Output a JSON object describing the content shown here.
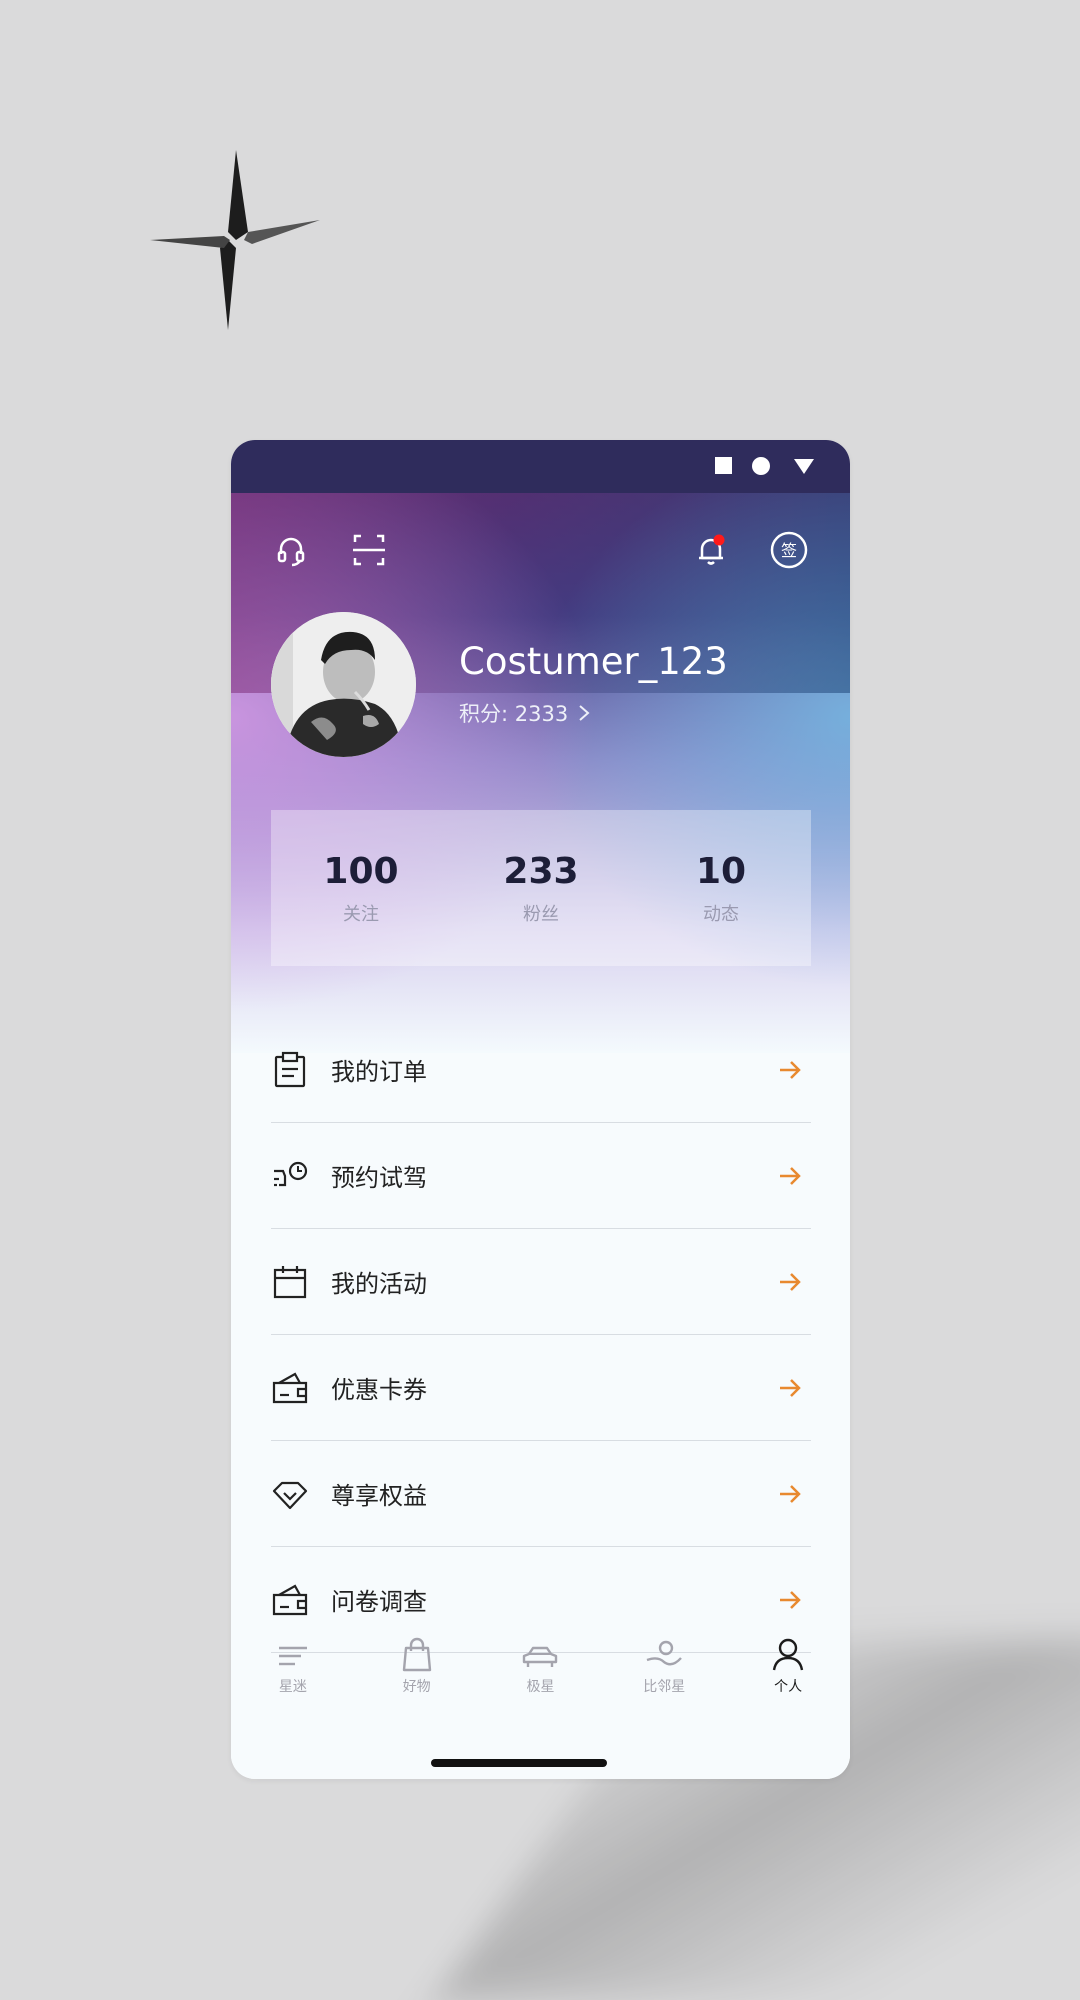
{
  "status_bar": {
    "icons": [
      "square-icon",
      "circle-icon",
      "triangle-down-icon"
    ]
  },
  "header_icons": [
    "headset-icon",
    "scan-icon",
    "bell-icon",
    "sign-in-icon"
  ],
  "sign_in_badge": "签",
  "profile": {
    "username": "Costumer_123",
    "points_label": "积分: 2333"
  },
  "stats": [
    {
      "value": "100",
      "label": "关注"
    },
    {
      "value": "233",
      "label": "粉丝"
    },
    {
      "value": "10",
      "label": "动态"
    }
  ],
  "menu": [
    {
      "label": "我的订单",
      "icon": "clipboard-icon"
    },
    {
      "label": "预约试驾",
      "icon": "test-drive-clock-icon"
    },
    {
      "label": "我的活动",
      "icon": "calendar-icon"
    },
    {
      "label": "优惠卡券",
      "icon": "wallet-icon"
    },
    {
      "label": "尊享权益",
      "icon": "diamond-icon"
    },
    {
      "label": "问卷调查",
      "icon": "wallet-icon"
    }
  ],
  "tabs": [
    {
      "label": "星迷",
      "icon": "lines-icon"
    },
    {
      "label": "好物",
      "icon": "shopping-bag-icon"
    },
    {
      "label": "极星",
      "icon": "car-icon"
    },
    {
      "label": "比邻星",
      "icon": "neighbor-icon"
    },
    {
      "label": "个人",
      "icon": "person-icon",
      "active": true
    }
  ],
  "colors": {
    "accent_arrow": "#e8892f",
    "status_bar": "#2f2c5c",
    "notification_dot": "#ff1a1a"
  }
}
